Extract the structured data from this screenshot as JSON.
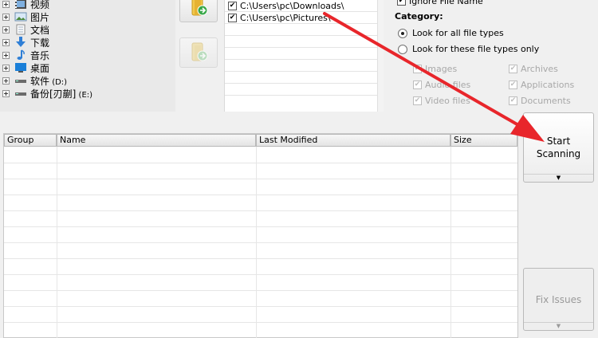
{
  "tree": {
    "items": [
      {
        "label": "视频",
        "sub": ""
      },
      {
        "label": "图片",
        "sub": ""
      },
      {
        "label": "文档",
        "sub": ""
      },
      {
        "label": "下载",
        "sub": ""
      },
      {
        "label": "音乐",
        "sub": ""
      },
      {
        "label": "桌面",
        "sub": ""
      },
      {
        "label": "软件",
        "sub": " (D:)"
      },
      {
        "label": "备份[刃蒯]",
        "sub": " (E:)"
      }
    ]
  },
  "folders": {
    "items": [
      {
        "path": "C:\\Users\\pc\\Downloads\\",
        "checked": "✔"
      },
      {
        "path": "C:\\Users\\pc\\Pictures\\",
        "checked": "✔"
      }
    ]
  },
  "options": {
    "ignore_file_name": "Ignore File Name",
    "category_title": "Category:",
    "look_all": "Look for all file types",
    "look_these": "Look for these file types only",
    "types": {
      "images": "Images",
      "archives": "Archives",
      "audio": "Audio files",
      "applications": "Applications",
      "video": "Video files",
      "documents": "Documents"
    }
  },
  "table": {
    "columns": [
      "Group",
      "Name",
      "Last Modified",
      "Size"
    ]
  },
  "actions": {
    "start_line1": "Start",
    "start_line2": "Scanning",
    "fix_issues": "Fix Issues"
  },
  "colors": {
    "annotation_arrow": "#e8262b",
    "folder_yellow": "#f2c84b",
    "add_green": "#3aa84a"
  }
}
